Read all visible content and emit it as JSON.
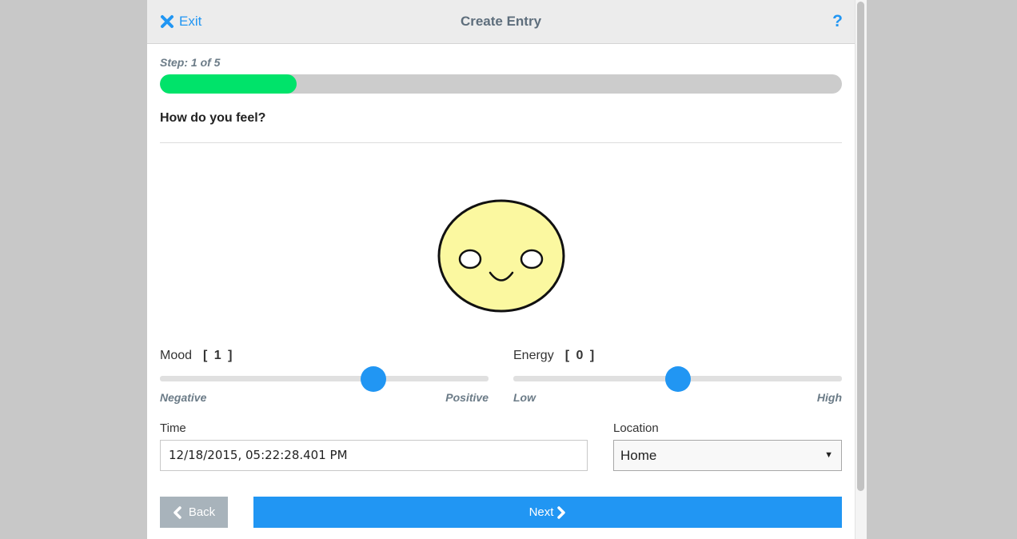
{
  "header": {
    "exit_label": "Exit",
    "title": "Create Entry",
    "help_label": "?"
  },
  "progress": {
    "step_label": "Step: 1 of 5",
    "fraction": 0.2
  },
  "question": "How do you feel?",
  "mood": {
    "title": "Mood",
    "value_display": "[ 1 ]",
    "min_label": "Negative",
    "max_label": "Positive",
    "level": 0.65
  },
  "energy": {
    "title": "Energy",
    "value_display": "[ 0 ]",
    "min_label": "Low",
    "max_label": "High",
    "level": 0.5
  },
  "time": {
    "label": "Time",
    "value": "12/18/2015, 05:22:28.401 PM"
  },
  "location": {
    "label": "Location",
    "selected": "Home"
  },
  "footer": {
    "back_label": "Back",
    "next_label": "Next"
  },
  "colors": {
    "accent": "#2196f3",
    "progress_fill": "#00e36a",
    "face_fill": "#fbf8a0",
    "back_disabled": "#a8b3bb"
  }
}
